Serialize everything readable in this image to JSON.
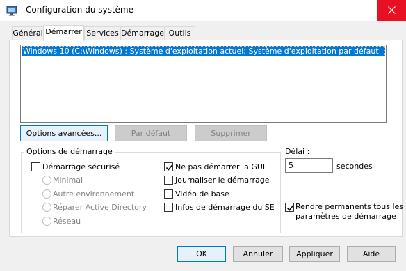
{
  "window": {
    "title": "Configuration du système",
    "close_icon": "close-icon",
    "app_icon": "system-config-icon",
    "close_color": "#e81123"
  },
  "tabs": [
    {
      "label": "Général",
      "active": false
    },
    {
      "label": "Démarrer",
      "active": true
    },
    {
      "label": "Services",
      "active": false
    },
    {
      "label": "Démarrage",
      "active": false
    },
    {
      "label": "Outils",
      "active": false
    }
  ],
  "boot_list": {
    "selected_item": "Windows 10 (C:\\Windows) : Système d'exploitation actuel; Système d'exploitation par défaut",
    "selection_color": "#0078d7"
  },
  "list_buttons": {
    "advanced": "Options avancées...",
    "default": "Par défaut",
    "delete": "Supprimer"
  },
  "boot_options": {
    "title": "Options de démarrage",
    "safe_boot": {
      "label": "Démarrage sécurisé",
      "checked": false
    },
    "radios": [
      {
        "label": "Minimal",
        "enabled": false
      },
      {
        "label": "Autre environnement",
        "enabled": false
      },
      {
        "label": "Réparer Active Directory",
        "enabled": false
      },
      {
        "label": "Réseau",
        "enabled": false
      }
    ],
    "checks": [
      {
        "label": "Ne pas démarrer la GUI",
        "checked": true
      },
      {
        "label": "Journaliser le démarrage",
        "checked": false
      },
      {
        "label": "Vidéo de base",
        "checked": false
      },
      {
        "label": "Infos de démarrage du SE",
        "checked": false
      }
    ]
  },
  "timeout": {
    "label": "Délai :",
    "value": "5",
    "unit": "secondes"
  },
  "permanent": {
    "label_line1": "Rendre permanents tous les",
    "label_line2": "paramètres de démarrage",
    "checked": true
  },
  "footer": {
    "ok": "OK",
    "cancel": "Annuler",
    "apply": "Appliquer",
    "help": "Aide"
  }
}
